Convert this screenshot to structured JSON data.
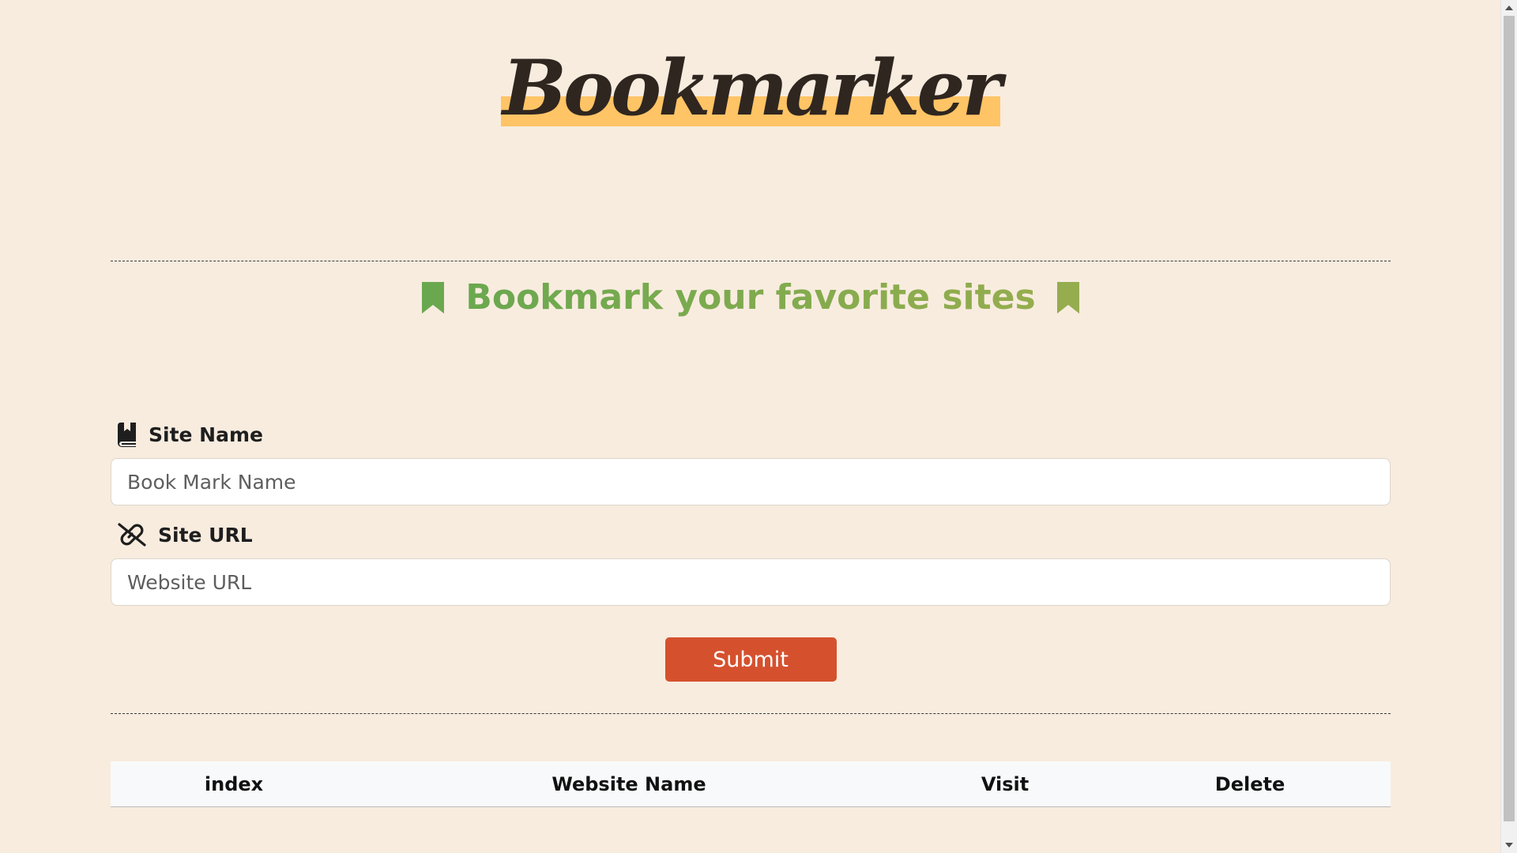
{
  "app": {
    "logo_text": "Bookmarker"
  },
  "tagline": {
    "text": "Bookmark your favorite sites"
  },
  "form": {
    "site_name": {
      "label": "Site Name",
      "placeholder": "Book Mark Name",
      "value": ""
    },
    "site_url": {
      "label": "Site URL",
      "placeholder": "Website URL",
      "value": ""
    },
    "submit_label": "Submit"
  },
  "table": {
    "headers": [
      "index",
      "Website Name",
      "Visit",
      "Delete"
    ],
    "rows": []
  },
  "icons": {
    "tagline_left": "bookmark-icon",
    "tagline_right": "bookmark-icon",
    "site_name": "book-bookmark-icon",
    "site_url": "link-slash-icon"
  },
  "colors": {
    "background": "#f8ecdf",
    "logo_highlight": "#ffc465",
    "tagline_start": "#6aa84f",
    "tagline_end": "#95ad4e",
    "submit_button": "#d5512e",
    "table_header_bg": "#f8f9fa"
  }
}
